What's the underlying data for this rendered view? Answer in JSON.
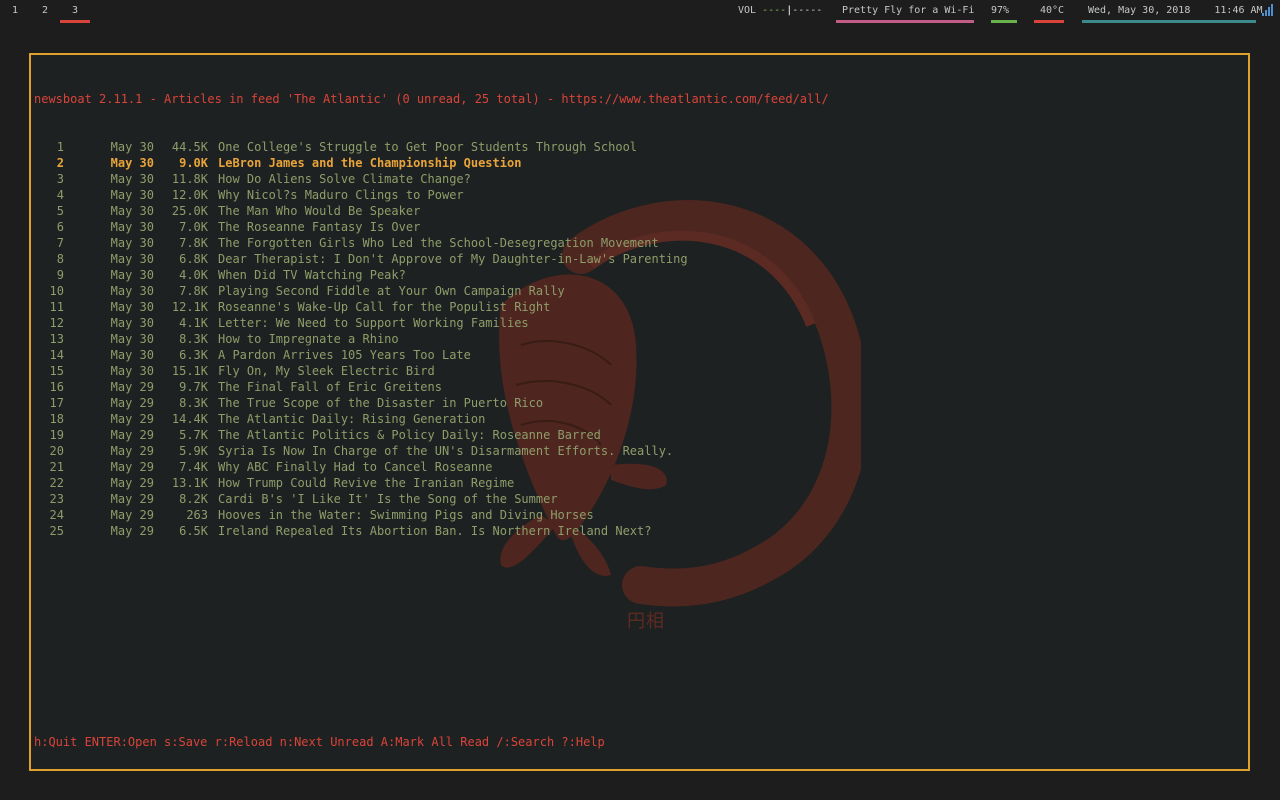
{
  "topbar": {
    "workspaces": [
      "1",
      "2",
      "3"
    ],
    "active_workspace": "3",
    "volume_label": "VOL",
    "volume_bar_left": "----",
    "volume_knob": "|",
    "volume_bar_right": "-----",
    "wifi_name": "Pretty Fly for a Wi-Fi",
    "battery": "97%",
    "temperature": "40°C",
    "date": "Wed, May 30, 2018",
    "time": "11:46 AM",
    "colors": {
      "wifi_underline": "#c25b86",
      "battery_underline": "#69b34c",
      "temp_underline": "#d9443a",
      "date_underline": "#3d8a8a",
      "active_ws_underline": "#d9443a"
    }
  },
  "terminal": {
    "header": "newsboat 2.11.1 - Articles in feed 'The Atlantic' (0 unread, 25 total) - https://www.theatlantic.com/feed/all/",
    "selected_index": 1,
    "articles": [
      {
        "num": "1",
        "date": "May 30",
        "size": "44.5K",
        "title": "One College's Struggle to Get Poor Students Through School"
      },
      {
        "num": "2",
        "date": "May 30",
        "size": "9.0K",
        "title": "LeBron James and the Championship Question"
      },
      {
        "num": "3",
        "date": "May 30",
        "size": "11.8K",
        "title": "How Do Aliens Solve Climate Change?"
      },
      {
        "num": "4",
        "date": "May 30",
        "size": "12.0K",
        "title": "Why Nicol?s Maduro Clings to Power"
      },
      {
        "num": "5",
        "date": "May 30",
        "size": "25.0K",
        "title": "The Man Who Would Be Speaker"
      },
      {
        "num": "6",
        "date": "May 30",
        "size": "7.0K",
        "title": "The Roseanne Fantasy Is Over"
      },
      {
        "num": "7",
        "date": "May 30",
        "size": "7.8K",
        "title": "The Forgotten Girls Who Led the School-Desegregation Movement"
      },
      {
        "num": "8",
        "date": "May 30",
        "size": "6.8K",
        "title": "Dear Therapist: I Don't Approve of My Daughter-in-Law's Parenting"
      },
      {
        "num": "9",
        "date": "May 30",
        "size": "4.0K",
        "title": "When Did TV Watching Peak?"
      },
      {
        "num": "10",
        "date": "May 30",
        "size": "7.8K",
        "title": "Playing Second Fiddle at Your Own Campaign Rally"
      },
      {
        "num": "11",
        "date": "May 30",
        "size": "12.1K",
        "title": "Roseanne's Wake-Up Call for the Populist Right"
      },
      {
        "num": "12",
        "date": "May 30",
        "size": "4.1K",
        "title": "Letter: We Need to Support Working Families"
      },
      {
        "num": "13",
        "date": "May 30",
        "size": "8.3K",
        "title": "How to Impregnate a Rhino"
      },
      {
        "num": "14",
        "date": "May 30",
        "size": "6.3K",
        "title": "A Pardon Arrives 105 Years Too Late"
      },
      {
        "num": "15",
        "date": "May 30",
        "size": "15.1K",
        "title": "Fly On, My Sleek Electric Bird"
      },
      {
        "num": "16",
        "date": "May 29",
        "size": "9.7K",
        "title": "The Final Fall of Eric Greitens"
      },
      {
        "num": "17",
        "date": "May 29",
        "size": "8.3K",
        "title": "The True Scope of the Disaster in Puerto Rico"
      },
      {
        "num": "18",
        "date": "May 29",
        "size": "14.4K",
        "title": "The Atlantic Daily: Rising Generation"
      },
      {
        "num": "19",
        "date": "May 29",
        "size": "5.7K",
        "title": "The Atlantic Politics & Policy Daily: Roseanne Barred"
      },
      {
        "num": "20",
        "date": "May 29",
        "size": "5.9K",
        "title": "Syria Is Now In Charge of the UN's Disarmament Efforts. Really."
      },
      {
        "num": "21",
        "date": "May 29",
        "size": "7.4K",
        "title": "Why ABC Finally Had to Cancel Roseanne"
      },
      {
        "num": "22",
        "date": "May 29",
        "size": "13.1K",
        "title": "How Trump Could Revive the Iranian Regime"
      },
      {
        "num": "23",
        "date": "May 29",
        "size": "8.2K",
        "title": "Cardi B's 'I Like It' Is the Song of the Summer"
      },
      {
        "num": "24",
        "date": "May 29",
        "size": "263",
        "title": "Hooves in the Water: Swimming Pigs and Diving Horses"
      },
      {
        "num": "25",
        "date": "May 29",
        "size": "6.5K",
        "title": "Ireland Repealed Its Abortion Ban. Is Northern Ireland Next?"
      }
    ],
    "footer": "h:Quit ENTER:Open s:Save r:Reload n:Next Unread A:Mark All Read /:Search ?:Help"
  },
  "wallpaper": {
    "caption": "円相",
    "icon": "koi-enso-icon"
  }
}
